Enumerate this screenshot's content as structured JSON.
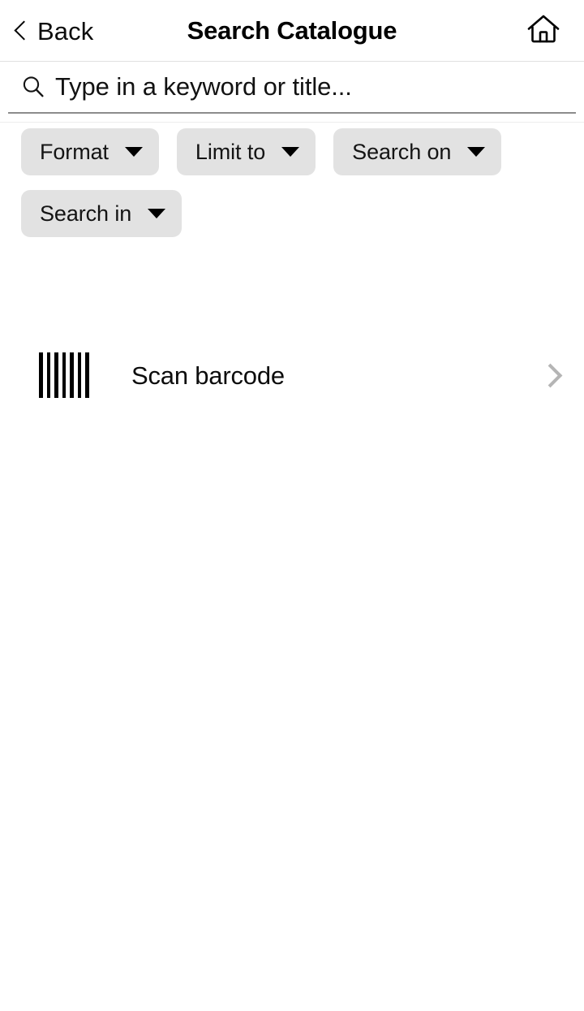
{
  "header": {
    "back_label": "Back",
    "title": "Search Catalogue",
    "back_icon": "chevron-left-icon",
    "home_icon": "home-icon"
  },
  "search": {
    "placeholder": "Type in a keyword or title...",
    "value": "",
    "icon": "search-icon"
  },
  "filters": [
    {
      "label": "Format",
      "icon": "chevron-down-icon"
    },
    {
      "label": "Limit to",
      "icon": "chevron-down-icon"
    },
    {
      "label": "Search on",
      "icon": "chevron-down-icon"
    },
    {
      "label": "Search in",
      "icon": "chevron-down-icon"
    }
  ],
  "scan": {
    "label": "Scan barcode",
    "icon": "barcode-icon",
    "chevron": "chevron-right-icon"
  },
  "colors": {
    "chip_background": "#e2e2e2",
    "text": "#0d0d0d",
    "divider": "#e0e0e0",
    "search_underline": "#8c8c8c",
    "chevron_gray": "#b5b5b5"
  }
}
